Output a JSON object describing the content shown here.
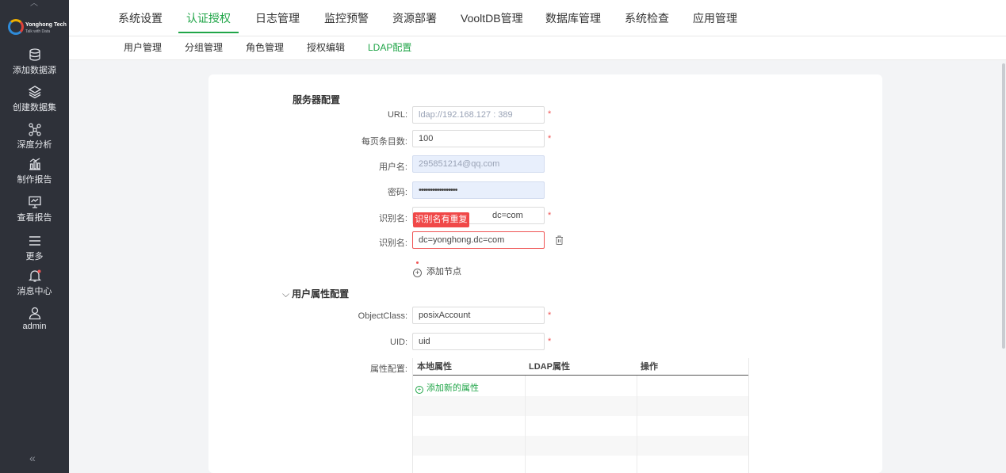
{
  "sidebar": {
    "logo": {
      "brand": "Yonghong Tech",
      "tagline": "Talk with Data"
    },
    "items": [
      {
        "label": "添加数据源",
        "icon": "database-icon"
      },
      {
        "label": "创建数据集",
        "icon": "layers-icon"
      },
      {
        "label": "深度分析",
        "icon": "analysis-nodes-icon"
      },
      {
        "label": "制作报告",
        "icon": "report-chart-icon"
      },
      {
        "label": "查看报告",
        "icon": "monitor-icon"
      },
      {
        "label": "更多",
        "icon": "menu-icon"
      },
      {
        "label": "消息中心",
        "icon": "bell-icon"
      },
      {
        "label": "admin",
        "icon": "user-icon"
      }
    ],
    "collapse_glyph": "«"
  },
  "top_tabs": [
    "系统设置",
    "认证授权",
    "日志管理",
    "监控预警",
    "资源部署",
    "VooltDB管理",
    "数据库管理",
    "系统检查",
    "应用管理"
  ],
  "sub_tabs": [
    "用户管理",
    "分组管理",
    "角色管理",
    "授权编辑",
    "LDAP配置"
  ],
  "server_config": {
    "title": "服务器配置",
    "url_label": "URL:",
    "url_value": "ldap://192.168.127 : 389",
    "page_size_label": "每页条目数:",
    "page_size_value": "100",
    "username_label": "用户名:",
    "username_value": "295851214@qq.com",
    "password_label": "密码:",
    "password_value": "•••••••••••••••••",
    "dn1_label": "识别名:",
    "dn1_value": "dc=com",
    "dn_error": "识别名有重复",
    "dn2_label": "识别名:",
    "dn2_value": "dc=yonghong.dc=com",
    "add_node": "添加节点",
    "required_mark": "*"
  },
  "user_attr_config": {
    "title": "用户属性配置",
    "collapse_glyph": "⌵",
    "objectclass_label": "ObjectClass:",
    "objectclass_value": "posixAccount",
    "uid_label": "UID:",
    "uid_value": "uid",
    "attr_label": "属性配置:",
    "table_headers": [
      "本地属性",
      "LDAP属性",
      "操作"
    ],
    "add_attr": "添加新的属性"
  },
  "colors": {
    "accent": "#20a548",
    "error": "#ef5454",
    "sidebar": "#2e3139"
  }
}
